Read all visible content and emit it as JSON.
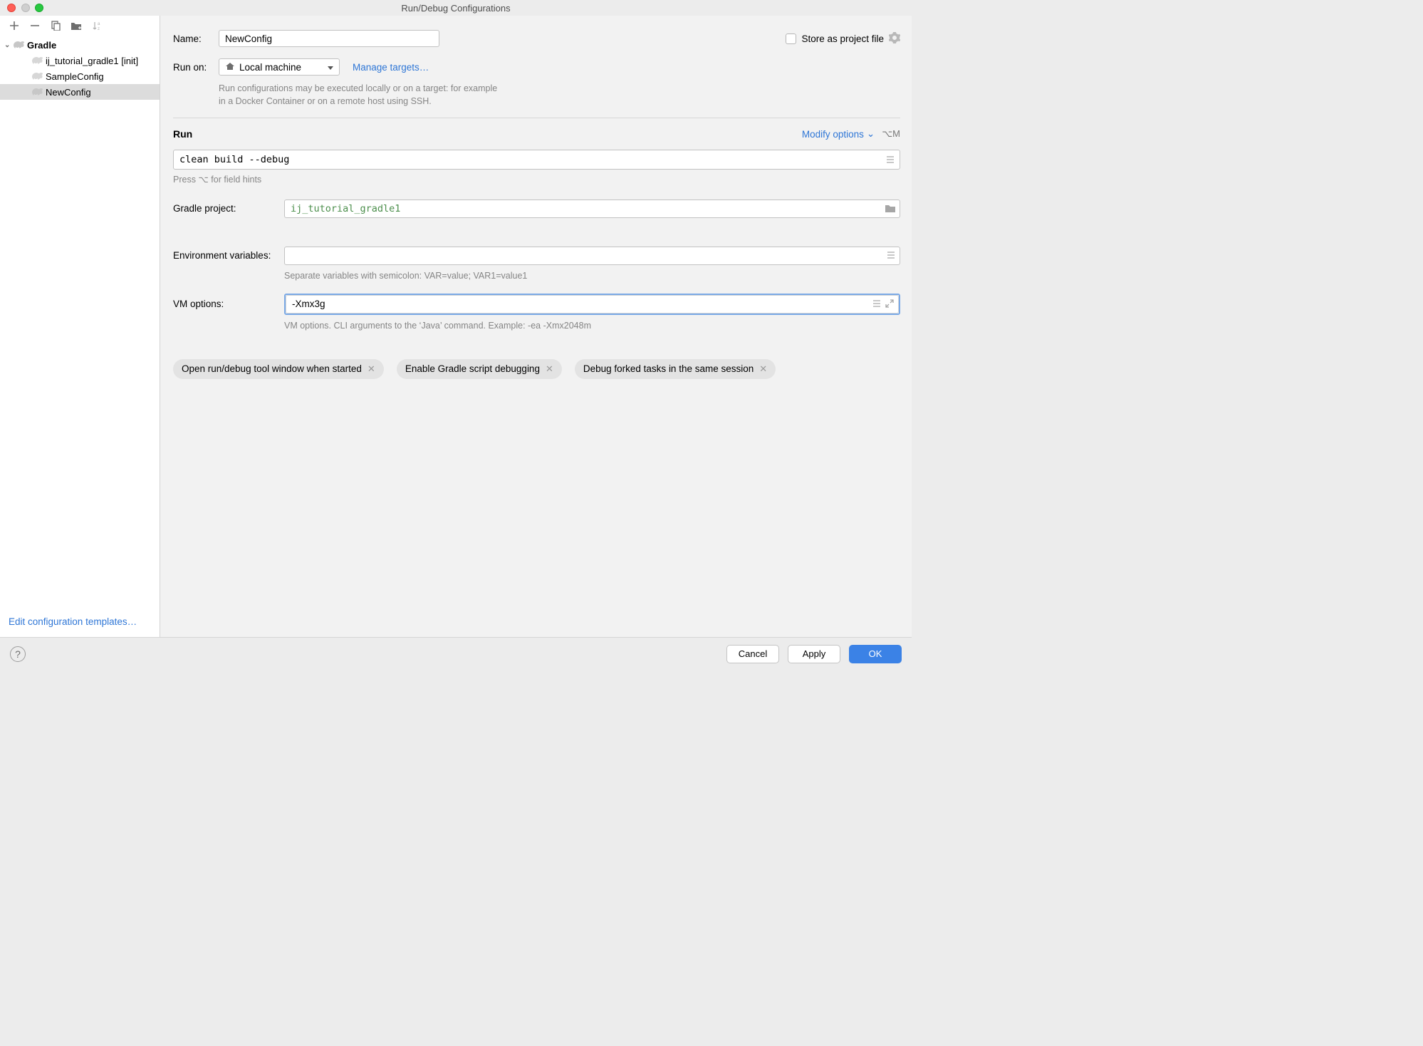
{
  "window": {
    "title": "Run/Debug Configurations"
  },
  "sidebar": {
    "group_label": "Gradle",
    "items": [
      {
        "label": "ij_tutorial_gradle1 [init]"
      },
      {
        "label": "SampleConfig"
      },
      {
        "label": "NewConfig",
        "selected": true
      }
    ],
    "edit_templates": "Edit configuration templates…"
  },
  "form": {
    "name_label": "Name:",
    "name_value": "NewConfig",
    "store_as_project_file": "Store as project file",
    "run_on_label": "Run on:",
    "run_on_value": "Local machine",
    "manage_targets": "Manage targets…",
    "run_on_hint": "Run configurations may be executed locally or on a target: for example in a Docker Container or on a remote host using SSH.",
    "run_section_title": "Run",
    "modify_options": "Modify options",
    "modify_shortcut": "⌥M",
    "tasks_value": "clean build --debug",
    "tasks_hint": "Press ⌥ for field hints",
    "gradle_project_label": "Gradle project:",
    "gradle_project_value": "ij_tutorial_gradle1",
    "env_label": "Environment variables:",
    "env_value": "",
    "env_hint": "Separate variables with semicolon: VAR=value; VAR1=value1",
    "vm_label": "VM options:",
    "vm_value": "-Xmx3g",
    "vm_hint": "VM options. CLI arguments to the ‘Java’ command. Example: -ea -Xmx2048m",
    "chips": [
      "Open run/debug tool window when started",
      "Enable Gradle script debugging",
      "Debug forked tasks in the same session"
    ]
  },
  "buttons": {
    "cancel": "Cancel",
    "apply": "Apply",
    "ok": "OK"
  }
}
